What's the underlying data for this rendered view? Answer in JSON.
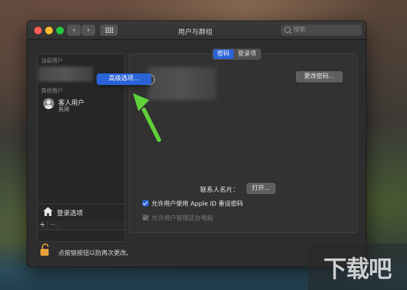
{
  "window": {
    "title": "用户与群组",
    "search_placeholder": "搜索"
  },
  "sidebar": {
    "current_users_label": "当前用户",
    "other_users_label": "其他用户",
    "guest": {
      "name": "客人用户",
      "status": "关闭"
    },
    "login_options_label": "登录选项",
    "add_label": "+",
    "remove_label": "−"
  },
  "popup": {
    "label": "高级选项..."
  },
  "main": {
    "tabs": [
      {
        "label": "密码",
        "active": true
      },
      {
        "label": "登录项",
        "active": false
      }
    ],
    "change_password_label": "更改密码...",
    "contact_card_label": "联系人名片：",
    "open_label": "打开...",
    "allow_reset_label": "允许用户使用 Apple ID 重设密码",
    "allow_admin_label": "允许用户管理这台电脑"
  },
  "footer": {
    "lock_text": "点按锁按钮以防再次更改。"
  },
  "watermark": {
    "text": "下载吧"
  },
  "colors": {
    "accent": "#2a62d8",
    "arrow": "#5fd13a"
  }
}
